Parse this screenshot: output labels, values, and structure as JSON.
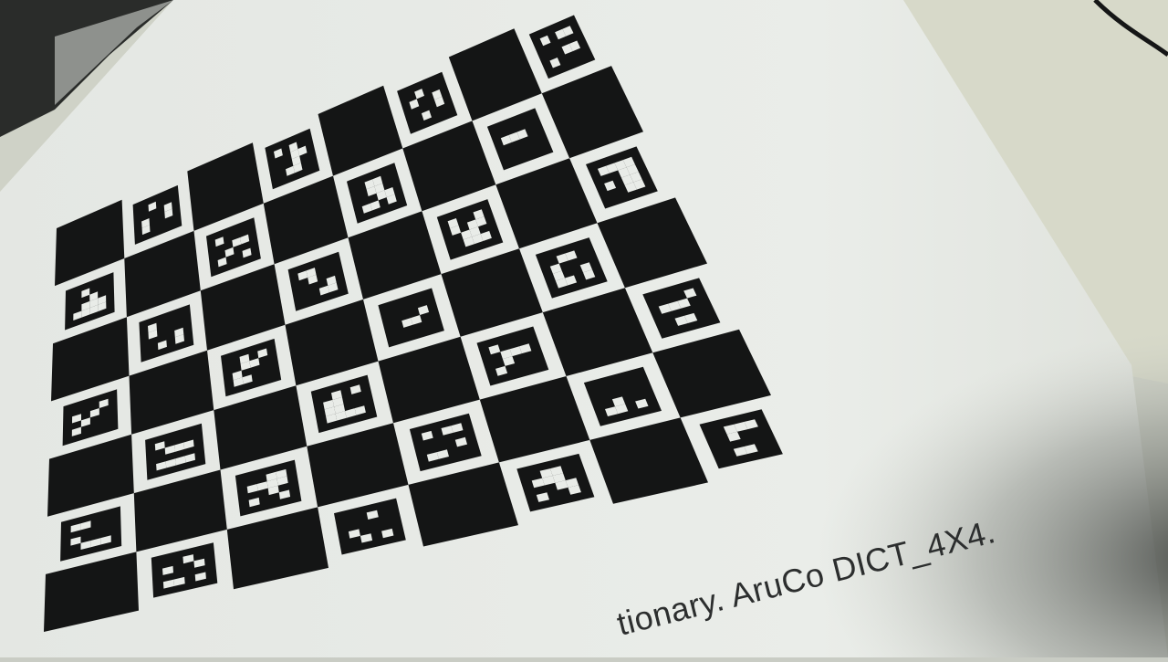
{
  "photo": {
    "subject": "printed ChArUco calibration board",
    "caption_text": "tionary. AruCo DICT_4X4.",
    "colors": {
      "paper": "#e9ece8",
      "paper_shadow": "#bfc2bb",
      "ink": "#141515",
      "background_left": "#2a2c2a",
      "background_right": "#d7d9c9"
    },
    "board": {
      "rows": 7,
      "cols": 8,
      "first_square_black": true,
      "marker_dictionary": "DICT_4X4"
    }
  }
}
